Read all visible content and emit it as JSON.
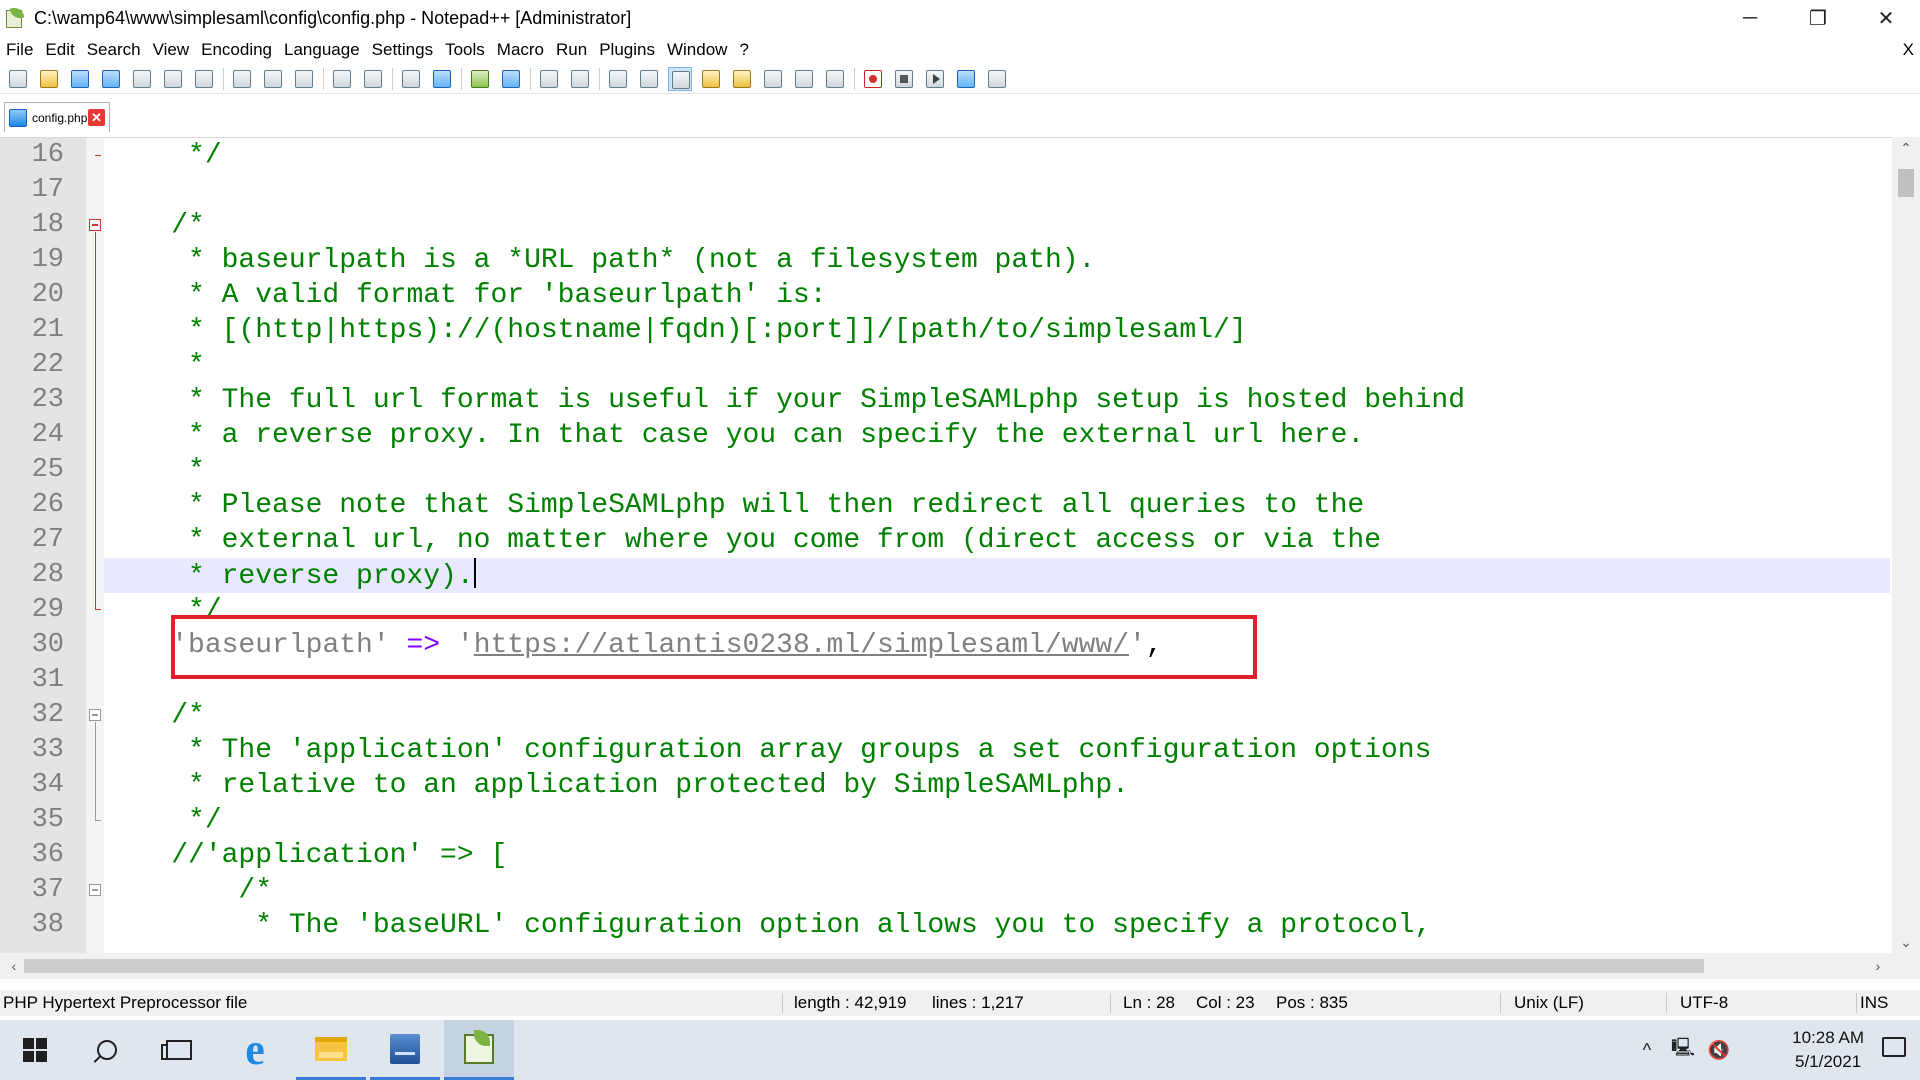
{
  "window": {
    "title": "C:\\wamp64\\www\\simplesaml\\config\\config.php - Notepad++ [Administrator]",
    "minimize_glyph": "─",
    "restore_glyph": "❐",
    "close_glyph": "✕"
  },
  "menu": {
    "items": [
      "File",
      "Edit",
      "Search",
      "View",
      "Encoding",
      "Language",
      "Settings",
      "Tools",
      "Macro",
      "Run",
      "Plugins",
      "Window",
      "?"
    ],
    "close_doc": "X"
  },
  "tab": {
    "label": "config.php",
    "close_glyph": "✕"
  },
  "editor": {
    "current_line": 28,
    "lines": [
      {
        "n": "16",
        "text": "     */"
      },
      {
        "n": "17",
        "text": ""
      },
      {
        "n": "18",
        "text": "    /*"
      },
      {
        "n": "19",
        "text": "     * baseurlpath is a *URL path* (not a filesystem path)."
      },
      {
        "n": "20",
        "text": "     * A valid format for 'baseurlpath' is:"
      },
      {
        "n": "21",
        "text": "     * [(http|https)://(hostname|fqdn)[:port]]/[path/to/simplesaml/]"
      },
      {
        "n": "22",
        "text": "     *"
      },
      {
        "n": "23",
        "text": "     * The full url format is useful if your SimpleSAMLphp setup is hosted behind"
      },
      {
        "n": "24",
        "text": "     * a reverse proxy. In that case you can specify the external url here."
      },
      {
        "n": "25",
        "text": "     *"
      },
      {
        "n": "26",
        "text": "     * Please note that SimpleSAMLphp will then redirect all queries to the"
      },
      {
        "n": "27",
        "text": "     * external url, no matter where you come from (direct access or via the"
      },
      {
        "n": "28",
        "text": "     * reverse proxy)."
      },
      {
        "n": "29",
        "text": "     */"
      },
      {
        "n": "30",
        "text": ""
      },
      {
        "n": "31",
        "text": ""
      },
      {
        "n": "32",
        "text": "    /*"
      },
      {
        "n": "33",
        "text": "     * The 'application' configuration array groups a set configuration options"
      },
      {
        "n": "34",
        "text": "     * relative to an application protected by SimpleSAMLphp."
      },
      {
        "n": "35",
        "text": "     */"
      },
      {
        "n": "36",
        "text": "    //'application' => ["
      },
      {
        "n": "37",
        "text": "        /*"
      },
      {
        "n": "38",
        "text": "         * The 'baseURL' configuration option allows you to specify a protocol,"
      }
    ],
    "line30": {
      "indent": "    ",
      "key": "'baseurlpath'",
      "arrow": " => ",
      "quote_open": "'",
      "url": "https://atlantis0238.ml/simplesaml/www/",
      "quote_close": "'",
      "comma": ","
    }
  },
  "status": {
    "file_type": "PHP Hypertext Preprocessor file",
    "length": "length : 42,919",
    "lines": "lines : 1,217",
    "ln": "Ln : 28",
    "col": "Col : 23",
    "pos": "Pos : 835",
    "eol": "Unix (LF)",
    "encoding": "UTF-8",
    "mode": "INS"
  },
  "taskbar": {
    "time": "10:28 AM",
    "date": "5/1/2021",
    "ie_glyph": "e",
    "tray_chevron": "^"
  }
}
